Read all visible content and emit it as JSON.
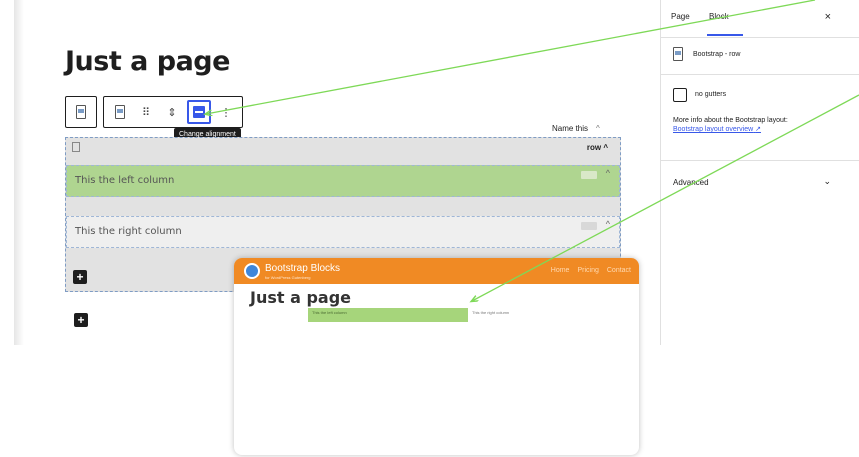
{
  "editor": {
    "page_title": "Just a page",
    "toolbar": {
      "tooltip": "Change alignment"
    },
    "row": {
      "label": "Name this",
      "block_name": "row",
      "left_column": "This the left column",
      "right_column": "This the right column"
    }
  },
  "sidebar": {
    "tabs": [
      "Page",
      "Block"
    ],
    "active_tab": "Block",
    "close_label": "×",
    "block_name": "Bootstrap - row",
    "checkbox_label": "no gutters",
    "info_text": "More info about the Bootstrap layout:",
    "info_link": "Bootstrap layout overview",
    "advanced_label": "Advanced"
  },
  "preview": {
    "brand": "Bootstrap Blocks",
    "brand_sub": "for WordPress Gutenberg",
    "nav_links": [
      "Home",
      "Pricing",
      "Contact"
    ],
    "title": "Just a page",
    "left_column": "This the left column",
    "right_column": "This the right column"
  },
  "colors": {
    "accent": "#3858e9",
    "arrow": "#7ed957",
    "column_green": "#afd590",
    "preview_nav": "#f08a24"
  },
  "icons": [
    "doc-icon",
    "drag-handle-icon",
    "move-arrows-icon",
    "align-icon",
    "more-options-icon",
    "plus-icon",
    "chevron-up-icon",
    "chevron-down-icon",
    "external-link-icon",
    "close-icon"
  ]
}
